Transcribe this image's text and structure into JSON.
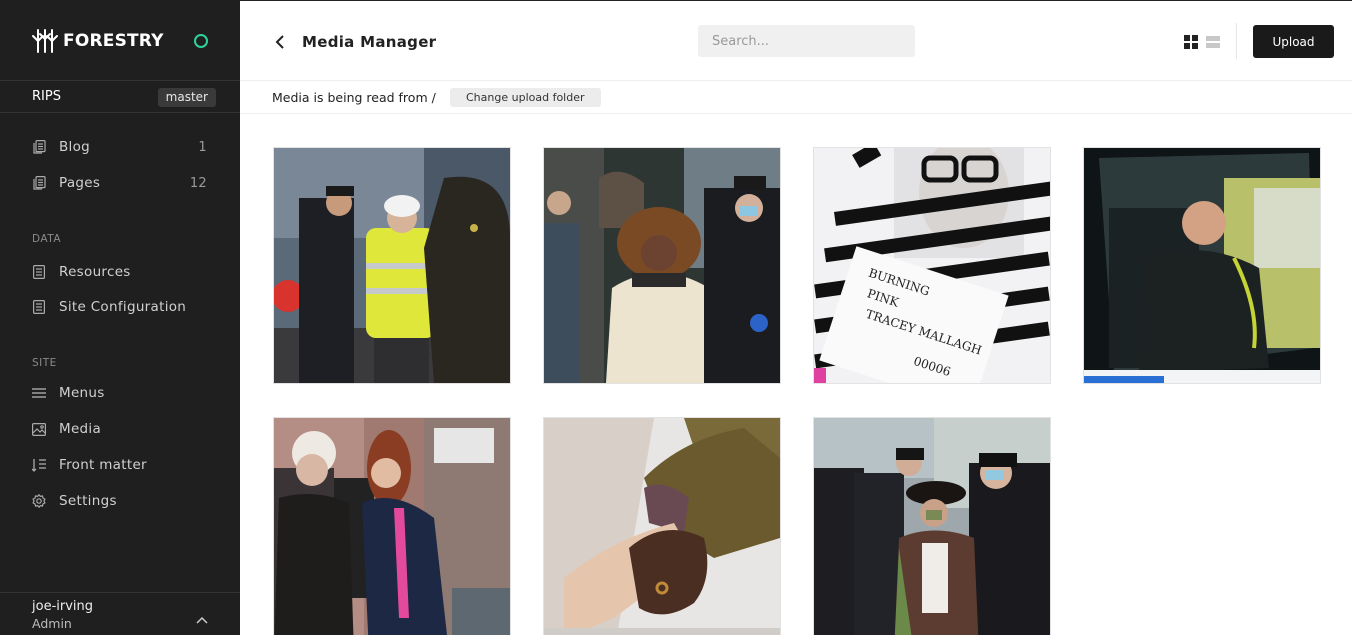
{
  "brand": {
    "name": "FORESTRY",
    "logo_icon": "forestry-logo-icon",
    "status_color": "#2ed39a"
  },
  "site": {
    "name": "RIPS",
    "branch": "master"
  },
  "nav": {
    "content": [
      {
        "label": "Blog",
        "count": "1",
        "icon": "document-icon"
      },
      {
        "label": "Pages",
        "count": "12",
        "icon": "document-icon"
      }
    ],
    "data_label": "DATA",
    "data": [
      {
        "label": "Resources",
        "icon": "document-icon"
      },
      {
        "label": "Site Configuration",
        "icon": "document-icon"
      }
    ],
    "site_label": "SITE",
    "site": [
      {
        "label": "Menus",
        "icon": "menu-icon"
      },
      {
        "label": "Media",
        "icon": "image-icon"
      },
      {
        "label": "Front matter",
        "icon": "front-matter-icon"
      },
      {
        "label": "Settings",
        "icon": "gear-icon"
      }
    ]
  },
  "user": {
    "name": "joe-irving",
    "role": "Admin"
  },
  "header": {
    "title": "Media Manager",
    "search_placeholder": "Search...",
    "upload_label": "Upload"
  },
  "folder": {
    "text": "Media is being read from /",
    "change_label": "Change upload folder"
  },
  "media": [
    {
      "name": "protester-hi-vis-police-photo"
    },
    {
      "name": "woman-police-officers-photo"
    },
    {
      "name": "striped-shirt-placard-photo"
    },
    {
      "name": "man-in-van-photo"
    },
    {
      "name": "two-women-doorway-photo"
    },
    {
      "name": "holding-hands-photo"
    },
    {
      "name": "woman-hat-police-photo"
    }
  ]
}
